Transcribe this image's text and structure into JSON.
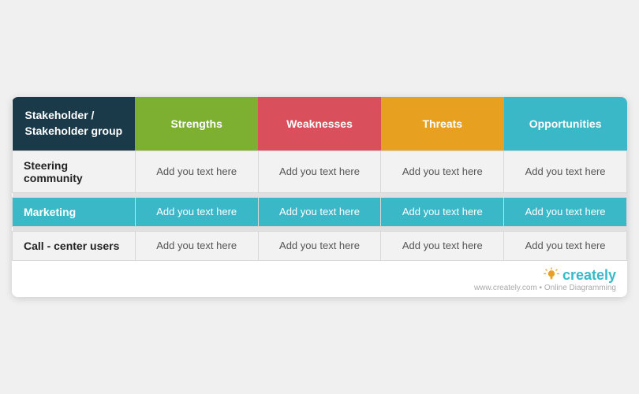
{
  "header": {
    "col1": "Stakeholder /\nStakeholder group",
    "col2": "Strengths",
    "col3": "Weaknesses",
    "col4": "Threats",
    "col5": "Opportunities"
  },
  "rows": [
    {
      "label": "Steering community",
      "cells": [
        "Add you text here",
        "Add you text here",
        "Add you text here",
        "Add you text here"
      ],
      "style": "white"
    },
    {
      "label": "Marketing",
      "cells": [
        "Add you text here",
        "Add you text here",
        "Add you text here",
        "Add you text here"
      ],
      "style": "teal"
    },
    {
      "label": "Call - center users",
      "cells": [
        "Add you text here",
        "Add you text here",
        "Add you text here",
        "Add you text here"
      ],
      "style": "bottom"
    }
  ],
  "footer": {
    "url": "www.creately.com",
    "tagline": "Online Diagramming",
    "brand": "creately"
  },
  "colors": {
    "dark_blue": "#1a3a4a",
    "green": "#7db030",
    "red": "#d94f5c",
    "amber": "#e8a020",
    "teal": "#3ab8c8"
  }
}
